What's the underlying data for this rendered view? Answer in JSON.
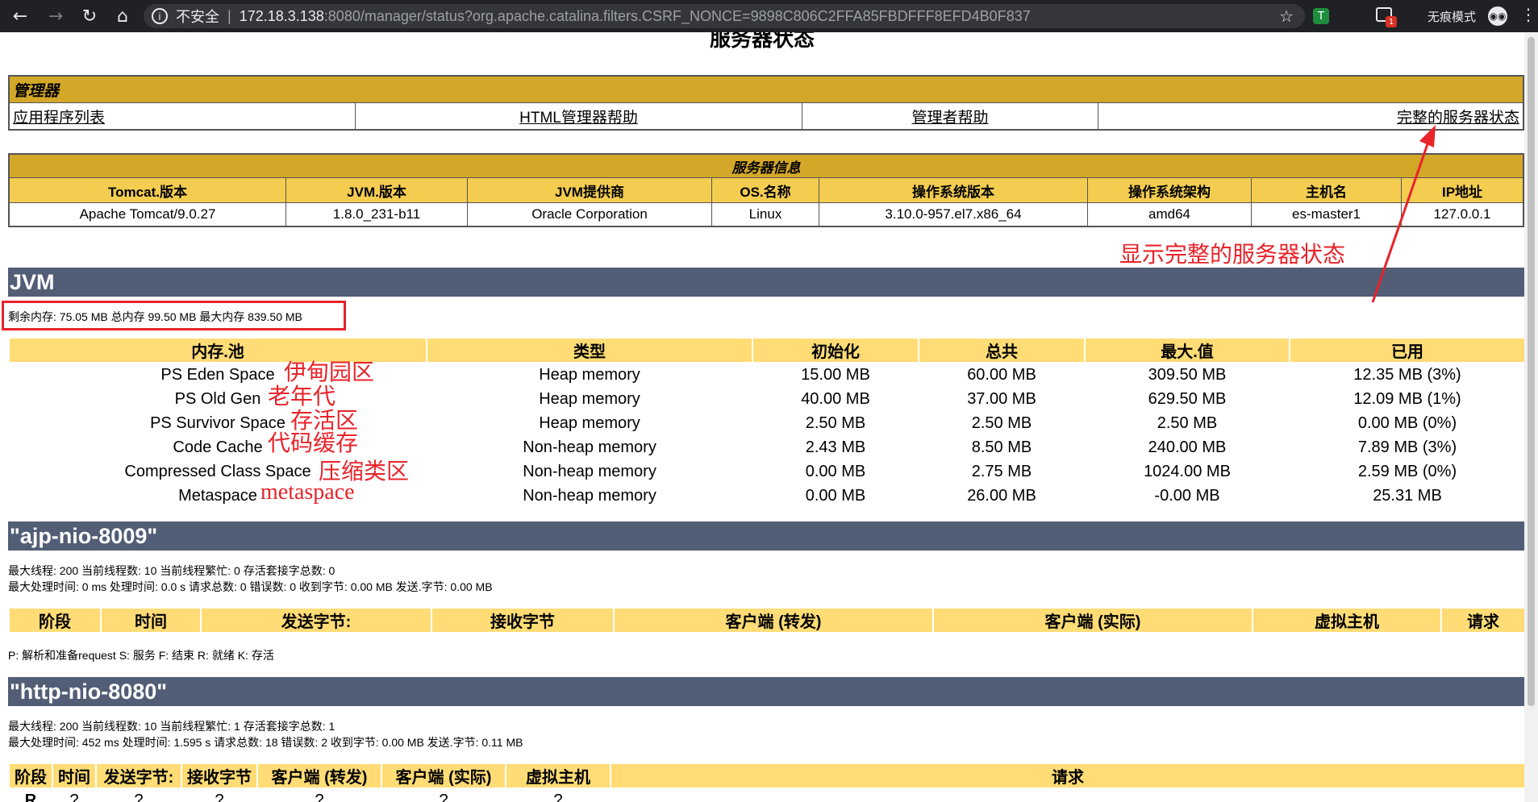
{
  "browser": {
    "insecure_label": "不安全",
    "url_host": "172.18.3.138",
    "url_path": ":8080/manager/status?org.apache.catalina.filters.CSRF_NONCE=9898C806C2FFA85FBDFFF8EFD4B0F837",
    "incognito_label": "无痕模式",
    "ext_badge_count": "1",
    "ext_green_letter": "T"
  },
  "page": {
    "title": "服务器状态",
    "manager": {
      "header": "管理器",
      "links": [
        "应用程序列表",
        "HTML管理器帮助",
        "管理者帮助",
        "完整的服务器状态"
      ]
    },
    "server_info": {
      "header": "服务器信息",
      "columns": [
        "Tomcat.版本",
        "JVM.版本",
        "JVM提供商",
        "OS.名称",
        "操作系统版本",
        "操作系统架构",
        "主机名",
        "IP地址"
      ],
      "values": [
        "Apache Tomcat/9.0.27",
        "1.8.0_231-b11",
        "Oracle Corporation",
        "Linux",
        "3.10.0-957.el7.x86_64",
        "amd64",
        "es-master1",
        "127.0.0.1"
      ]
    },
    "jvm": {
      "title": "JVM",
      "memory_line": "剩余内存: 75.05 MB 总内存 99.50 MB 最大内存 839.50 MB",
      "pool_columns": [
        "内存.池",
        "类型",
        "初始化",
        "总共",
        "最大.值",
        "已用"
      ],
      "pools": [
        [
          "PS Eden Space",
          "Heap memory",
          "15.00 MB",
          "60.00 MB",
          "309.50 MB",
          "12.35 MB (3%)"
        ],
        [
          "PS Old Gen",
          "Heap memory",
          "40.00 MB",
          "37.00 MB",
          "629.50 MB",
          "12.09 MB (1%)"
        ],
        [
          "PS Survivor Space",
          "Heap memory",
          "2.50 MB",
          "2.50 MB",
          "2.50 MB",
          "0.00 MB (0%)"
        ],
        [
          "Code Cache",
          "Non-heap memory",
          "2.43 MB",
          "8.50 MB",
          "240.00 MB",
          "7.89 MB (3%)"
        ],
        [
          "Compressed Class Space",
          "Non-heap memory",
          "0.00 MB",
          "2.75 MB",
          "1024.00 MB",
          "2.59 MB (0%)"
        ],
        [
          "Metaspace",
          "Non-heap memory",
          "0.00 MB",
          "26.00 MB",
          "-0.00 MB",
          "25.31 MB"
        ]
      ]
    },
    "ajp": {
      "title": "\"ajp-nio-8009\"",
      "line1": "最大线程: 200 当前线程数: 10 当前线程繁忙: 0 存活套接字总数: 0",
      "line2": "最大处理时间: 0 ms 处理时间: 0.0 s 请求总数: 0 错误数: 0 收到字节: 0.00 MB 发送.字节: 0.00 MB",
      "columns": [
        "阶段",
        "时间",
        "发送字节:",
        "接收字节",
        "客户端 (转发)",
        "客户端 (实际)",
        "虚拟主机",
        "请求"
      ],
      "legend": "P: 解析和准备request S: 服务 F: 结束 R: 就绪 K: 存活"
    },
    "http": {
      "title": "\"http-nio-8080\"",
      "line1": "最大线程: 200 当前线程数: 10 当前线程繁忙: 1 存活套接字总数: 1",
      "line2": "最大处理时间: 452 ms 处理时间: 1.595 s 请求总数: 18 错误数: 2 收到字节: 0.00 MB 发送.字节: 0.11 MB",
      "columns": [
        "阶段",
        "时间",
        "发送字节:",
        "接收字节",
        "客户端 (转发)",
        "客户端 (实际)",
        "虚拟主机",
        "请求"
      ],
      "partial_row": [
        "R",
        "?",
        "?",
        "?",
        "?",
        "?",
        "?"
      ]
    }
  },
  "annotations": {
    "arrow_note": "显示完整的服务器状态",
    "pool_notes": [
      "伊甸园区",
      "老年代",
      "存活区",
      "代码缓存",
      "压缩类区",
      "metaspace"
    ],
    "color": "#e8232a"
  }
}
